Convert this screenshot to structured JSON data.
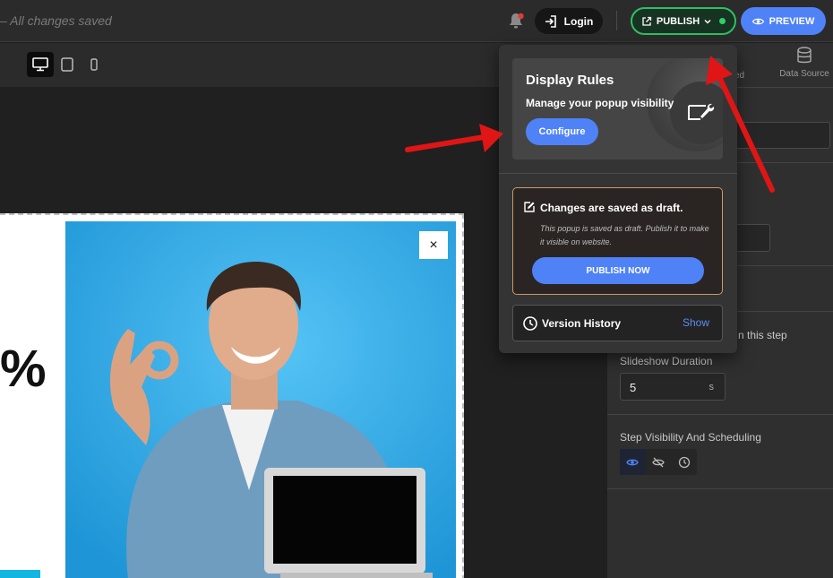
{
  "header": {
    "save_status": "– All changes saved",
    "login_label": "Login",
    "publish_label": "PUBLISH",
    "preview_label": "PREVIEW"
  },
  "toolbar": {
    "device_icons": [
      "desktop-icon",
      "tablet-icon",
      "mobile-icon"
    ],
    "active_device": "desktop"
  },
  "canvas": {
    "popup_percent_text": "%",
    "close_label": "×"
  },
  "right_panel": {
    "partial_tab_label": "ed",
    "data_source_label": "Data Source",
    "step_text_partial": "n this step",
    "slideshow_duration_label": "Slideshow Duration",
    "slideshow_duration_value": "5",
    "slideshow_duration_unit": "s",
    "visibility_label": "Step Visibility And Scheduling",
    "visibility_icons": [
      "eye-icon",
      "eye-off-icon",
      "clock-icon"
    ]
  },
  "dropdown": {
    "display_rules_title": "Display Rules",
    "display_rules_subtitle": "Manage your popup visibility",
    "configure_label": "Configure",
    "draft_title": "Changes are saved as draft.",
    "draft_description": "This popup is saved as draft. Publish it to make it visible on website.",
    "publish_now_label": "PUBLISH NOW",
    "version_history_label": "Version History",
    "version_history_show": "Show"
  },
  "colors": {
    "accent_blue": "#4f82f7",
    "publish_green": "#2fbf63",
    "draft_border": "#c89a6a",
    "annotation_red": "#e01515",
    "photo_bg": "#2aa7e6"
  }
}
